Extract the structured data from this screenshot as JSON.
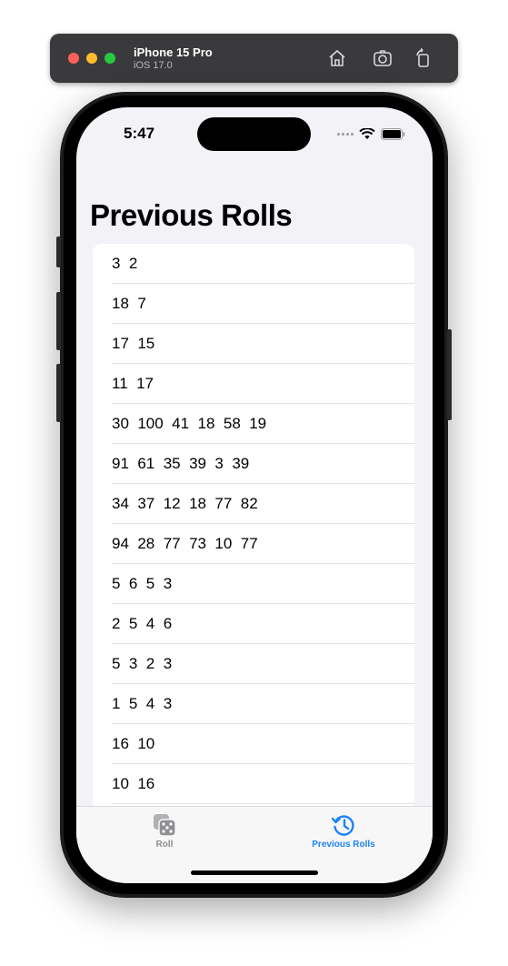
{
  "window": {
    "device_name": "iPhone 15 Pro",
    "os_version": "iOS 17.0",
    "buttons": [
      "home-icon",
      "screenshot-icon",
      "rotate-icon"
    ]
  },
  "status_bar": {
    "time": "5:47"
  },
  "nav": {
    "title": "Previous Rolls"
  },
  "rolls": [
    "3  2",
    "18  7",
    "17  15",
    "11  17",
    "30  100  41  18  58  19",
    "91  61  35  39  3  39",
    "34  37  12  18  77  82",
    "94  28  77  73  10  77",
    "5  6  5  3",
    "2  5  4  6",
    "5  3  2  3",
    "1  5  4  3",
    "16  10",
    "10  16"
  ],
  "tabs": [
    {
      "label": "Roll",
      "icon": "dice-icon",
      "selected": false
    },
    {
      "label": "Previous Rolls",
      "icon": "clock-history-icon",
      "selected": true
    }
  ],
  "colors": {
    "accent": "#1a84f7",
    "inactive_tab": "#8e8e93"
  }
}
